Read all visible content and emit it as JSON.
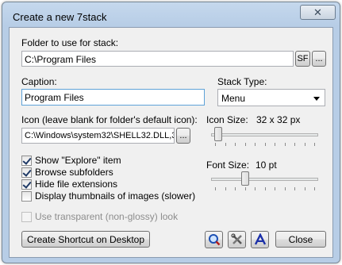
{
  "window": {
    "title": "Create a new 7stack",
    "close_glyph": "✕"
  },
  "folder": {
    "label": "Folder to use for stack:",
    "value": "C:\\Program Files",
    "sf_label": "SF",
    "browse_label": "..."
  },
  "caption": {
    "label": "Caption:",
    "value": "Program Files"
  },
  "stack_type": {
    "label": "Stack Type:",
    "selected": "Menu"
  },
  "icon": {
    "label": "Icon (leave blank for folder's default icon):",
    "value": "C:\\Windows\\system32\\SHELL32.DLL,3",
    "browse_label": "..."
  },
  "icon_size": {
    "label": "Icon Size:",
    "value_text": "32 x 32 px",
    "level": 0.03
  },
  "font_size": {
    "label": "Font Size:",
    "value_text": "10 pt",
    "level": 0.3
  },
  "options": [
    {
      "label": "Show \"Explore\" item",
      "checked": true
    },
    {
      "label": "Browse subfolders",
      "checked": true
    },
    {
      "label": "Hide file extensions",
      "checked": true
    },
    {
      "label": "Display thumbnails of images (slower)",
      "checked": false
    }
  ],
  "transparent_option": {
    "label": "Use transparent (non-glossy) look",
    "checked": false,
    "disabled": true
  },
  "buttons": {
    "shortcut_label": "Create Shortcut on Desktop",
    "close_label": "Close"
  },
  "icons": [
    "magnifier-icon",
    "tools-icon",
    "font-icon"
  ]
}
